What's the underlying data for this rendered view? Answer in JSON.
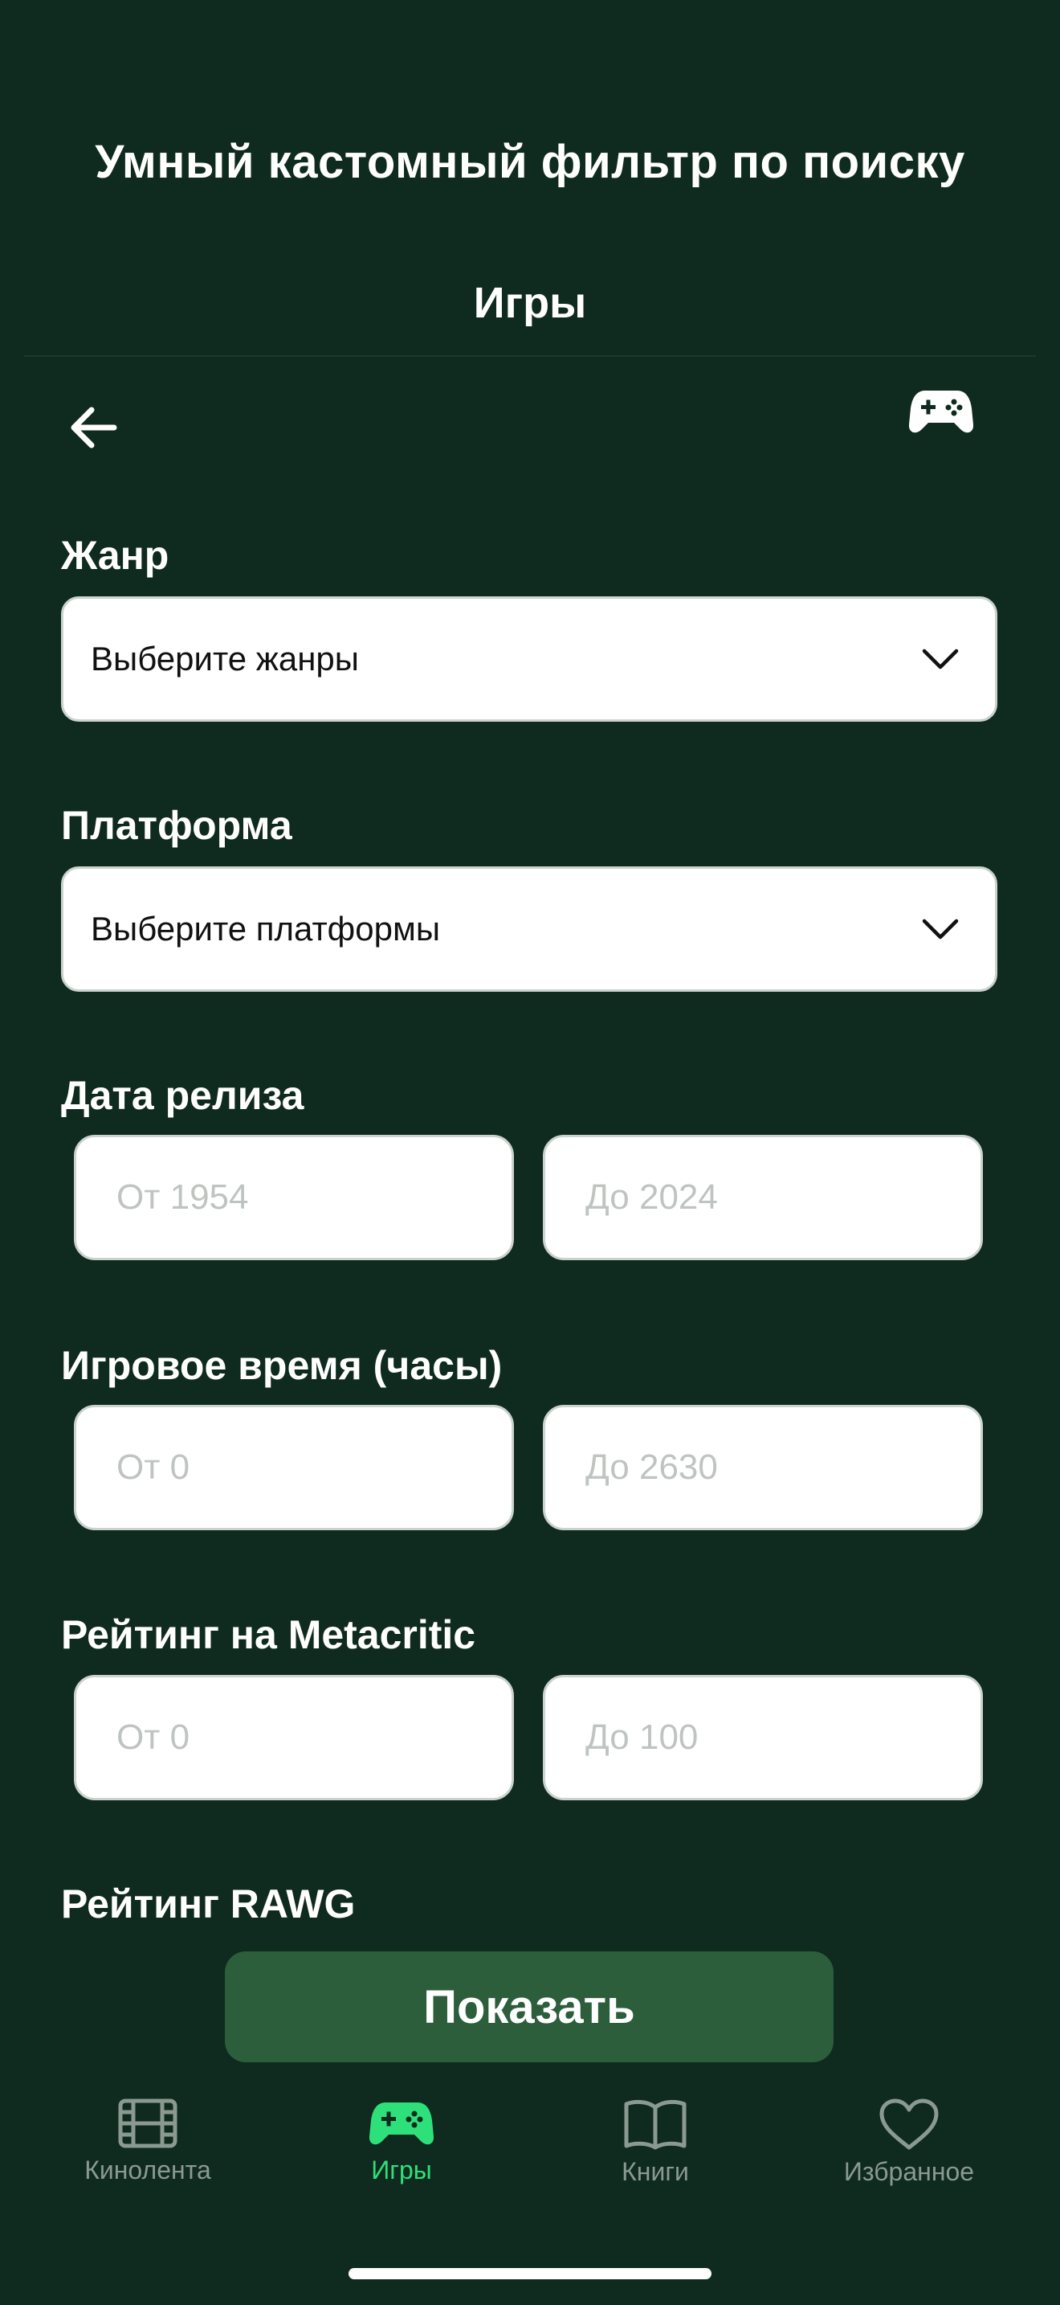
{
  "header": {
    "title": "Умный кастомный фильтр по поиску",
    "subtitle": "Игры"
  },
  "toolbar": {
    "back_icon": "arrow-left-icon",
    "category_icon": "gamepad-icon"
  },
  "filters": {
    "genre": {
      "label": "Жанр",
      "placeholder": "Выберите жанры"
    },
    "platform": {
      "label": "Платформа",
      "placeholder": "Выберите платформы"
    },
    "release_date": {
      "label": "Дата релиза",
      "from_placeholder": "От 1954",
      "to_placeholder": "До 2024"
    },
    "playtime": {
      "label": "Игровое время (часы)",
      "from_placeholder": "От 0",
      "to_placeholder": "До 2630"
    },
    "metacritic": {
      "label": "Рейтинг на Metacritic",
      "from_placeholder": "От 0",
      "to_placeholder": "До 100"
    },
    "rawg": {
      "label": "Рейтинг RAWG"
    }
  },
  "actions": {
    "show_label": "Показать"
  },
  "tabbar": {
    "items": [
      {
        "label": "Кинолента",
        "icon": "film-icon",
        "active": false
      },
      {
        "label": "Игры",
        "icon": "gamepad-icon",
        "active": true
      },
      {
        "label": "Книги",
        "icon": "book-icon",
        "active": false
      },
      {
        "label": "Избранное",
        "icon": "heart-icon",
        "active": false
      }
    ]
  },
  "colors": {
    "background": "#0f2a1e",
    "button": "#2d5e3c",
    "active_tab": "#2ee07a",
    "inactive_tab": "#8b9a91"
  }
}
